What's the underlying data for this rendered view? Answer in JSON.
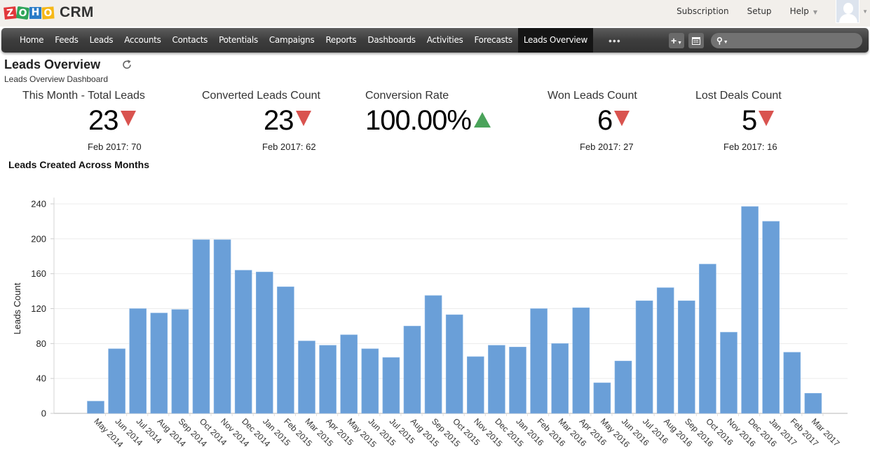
{
  "app": {
    "logo_letters": [
      "Z",
      "O",
      "H",
      "O"
    ],
    "product_name": "CRM"
  },
  "top_links": {
    "subscription": "Subscription",
    "setup": "Setup",
    "help": "Help"
  },
  "nav": {
    "items": [
      "Home",
      "Feeds",
      "Leads",
      "Accounts",
      "Contacts",
      "Potentials",
      "Campaigns",
      "Reports",
      "Dashboards",
      "Activities",
      "Forecasts",
      "Leads Overview"
    ],
    "active": "Leads Overview",
    "more_label": "•••",
    "plus_label": "+",
    "search_placeholder": ""
  },
  "page": {
    "title": "Leads Overview",
    "subtitle": "Leads Overview Dashboard"
  },
  "kpis": [
    {
      "label": "This Month - Total Leads",
      "value": "23",
      "trend": "down",
      "previous": "Feb 2017: 70"
    },
    {
      "label": "Converted Leads Count",
      "value": "23",
      "trend": "down",
      "previous": "Feb 2017: 62"
    },
    {
      "label": "Conversion Rate",
      "value": "100.00%",
      "trend": "up",
      "previous": ""
    },
    {
      "label": "Won Leads Count",
      "value": "6",
      "trend": "down",
      "previous": "Feb 2017: 27"
    },
    {
      "label": "Lost Deals Count",
      "value": "5",
      "trend": "down",
      "previous": "Feb 2017: 16"
    }
  ],
  "colors": {
    "bar": "#6a9fd8",
    "trend_down": "#d9534f",
    "trend_up": "#4aa35a",
    "nav_bg": "#3d3d3d",
    "active_tab": "#151515"
  },
  "chart_data": {
    "type": "bar",
    "title": "Leads Created Across Months",
    "xlabel": "",
    "ylabel": "Leads Count",
    "ylim": [
      0,
      240
    ],
    "yticks": [
      0,
      40,
      80,
      120,
      160,
      200,
      240
    ],
    "grid": true,
    "legend": "none",
    "categories": [
      "May 2014",
      "Jun 2014",
      "Jul 2014",
      "Aug 2014",
      "Sep 2014",
      "Oct 2014",
      "Nov 2014",
      "Dec 2014",
      "Jan 2015",
      "Feb 2015",
      "Mar 2015",
      "Apr 2015",
      "May 2015",
      "Jun 2015",
      "Jul 2015",
      "Aug 2015",
      "Sep 2015",
      "Oct 2015",
      "Nov 2015",
      "Dec 2015",
      "Jan 2016",
      "Feb 2016",
      "Mar 2016",
      "Apr 2016",
      "May 2016",
      "Jun 2016",
      "Jul 2016",
      "Aug 2016",
      "Sep 2016",
      "Oct 2016",
      "Nov 2016",
      "Dec 2016",
      "Jan 2017",
      "Feb 2017",
      "Mar 2017"
    ],
    "values": [
      14,
      74,
      120,
      115,
      119,
      199,
      199,
      164,
      162,
      145,
      83,
      78,
      90,
      74,
      64,
      100,
      135,
      113,
      65,
      78,
      76,
      120,
      80,
      121,
      35,
      60,
      129,
      144,
      129,
      171,
      93,
      237,
      220,
      70,
      23
    ]
  }
}
